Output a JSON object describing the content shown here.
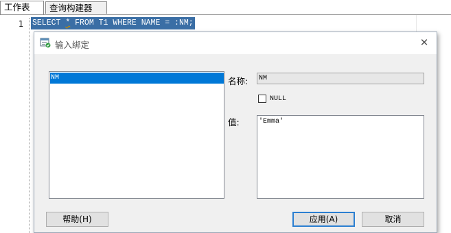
{
  "tabs": [
    "工作表",
    "查询构建器"
  ],
  "editor": {
    "line_number": "1",
    "sql_before": "SELECT ",
    "sql_star": "*",
    "sql_after": " FROM T1 WHERE NAME = :NM;"
  },
  "dialog": {
    "title": "输入绑定",
    "close_glyph": "✕",
    "bind_list": [
      "NM"
    ],
    "name_label": "名称:",
    "name_value": "NM",
    "null_label": "NULL",
    "value_label": "值:",
    "value_text": "'Emma'",
    "help_button": "帮助(H)",
    "apply_button": "应用(A)",
    "cancel_button": "取消"
  }
}
